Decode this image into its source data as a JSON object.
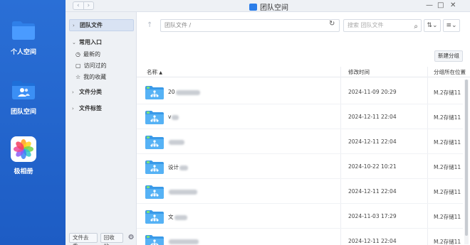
{
  "dock": {
    "apps": [
      {
        "label": "个人空间",
        "icon": "folder-icon",
        "color": "#3a8dfb"
      },
      {
        "label": "团队空间",
        "icon": "team-folder-icon",
        "color": "#2b7de9"
      },
      {
        "label": "极相册",
        "icon": "photos-icon",
        "color": "#ffffff"
      }
    ]
  },
  "window": {
    "title": "团队空间",
    "nav": {
      "back": "‹",
      "forward": "›"
    },
    "controls": {
      "minimize": "—",
      "maximize": "□",
      "close": "✕"
    }
  },
  "sidebar": {
    "team_files": "团队文件",
    "common": "常用入口",
    "common_items": [
      "最新的",
      "访问过的",
      "我的收藏"
    ],
    "categories": "文件分类",
    "tags": "文件标签",
    "footer": {
      "transfer": "文件去重",
      "recycle": "回收站"
    }
  },
  "toolbar": {
    "path": "团队文件 /",
    "search_placeholder": "搜索 团队文件",
    "new_group": "新建分组"
  },
  "table": {
    "headers": {
      "name": "名称",
      "sort_indicator": "▲",
      "modified": "修改时间",
      "partition": "分组所在位置"
    },
    "rows": [
      {
        "name": "20",
        "blur_width": 34,
        "modified": "2024-11-09 20:29",
        "partition": "M.2存储11"
      },
      {
        "name": "v",
        "blur_width": 10,
        "modified": "2024-12-11 22:04",
        "partition": "M.2存储11"
      },
      {
        "name": "",
        "blur_width": 22,
        "modified": "2024-12-11 22:04",
        "partition": "M.2存储11"
      },
      {
        "name": "设计",
        "blur_width": 12,
        "modified": "2024-10-22 10:21",
        "partition": "M.2存储11"
      },
      {
        "name": "",
        "blur_width": 40,
        "modified": "2024-12-11 22:04",
        "partition": "M.2存储11"
      },
      {
        "name": "文",
        "blur_width": 18,
        "modified": "2024-11-03 17:29",
        "partition": "M.2存储11"
      },
      {
        "name": "",
        "blur_width": 42,
        "modified": "2024-12-11 22:04",
        "partition": "M.2存储11"
      }
    ]
  }
}
